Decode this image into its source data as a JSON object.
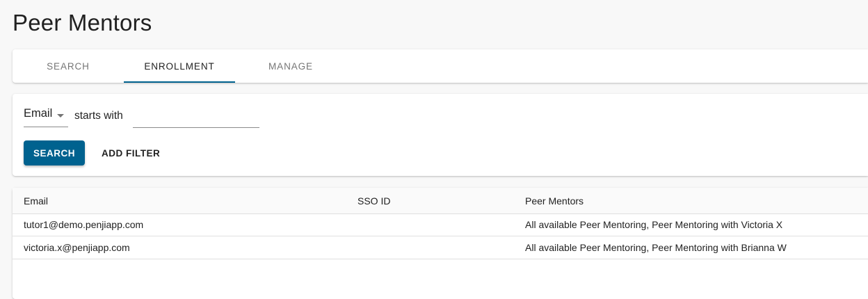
{
  "page": {
    "title": "Peer Mentors"
  },
  "tabs": [
    {
      "label": "SEARCH"
    },
    {
      "label": "ENROLLMENT"
    },
    {
      "label": "MANAGE"
    }
  ],
  "active_tab": "ENROLLMENT",
  "filter": {
    "field": "Email",
    "operator": "starts with",
    "value": "",
    "search_label": "SEARCH",
    "add_filter_label": "ADD FILTER"
  },
  "table": {
    "headers": [
      "Email",
      "SSO ID",
      "Peer Mentors"
    ],
    "rows": [
      {
        "email": "tutor1@demo.penjiapp.com",
        "sso_id": "",
        "mentors": "All available Peer Mentoring, Peer Mentoring with Victoria X"
      },
      {
        "email": "victoria.x@penjiapp.com",
        "sso_id": "",
        "mentors": "All available Peer Mentoring, Peer Mentoring with Brianna W"
      }
    ]
  },
  "colors": {
    "accent": "#00628f",
    "background": "#f8f8f8",
    "card": "#ffffff"
  }
}
